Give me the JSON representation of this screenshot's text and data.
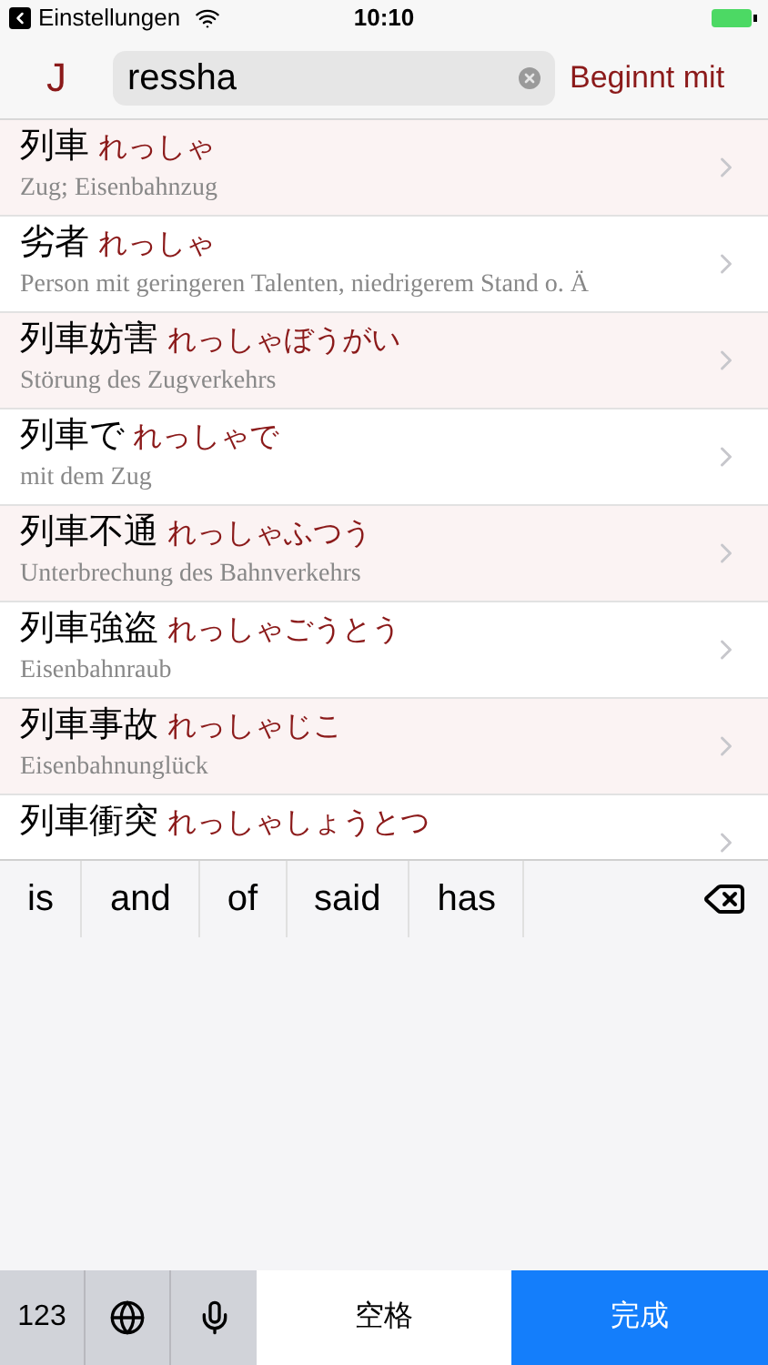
{
  "status_bar": {
    "back_label": "Einstellungen",
    "time": "10:10"
  },
  "nav": {
    "mode_button": "J",
    "search": {
      "value": "ressha"
    },
    "filter_button": "Beginnt mit"
  },
  "results": [
    {
      "word": "列車",
      "reading": "れっしゃ",
      "meaning": "Zug; Eisenbahnzug"
    },
    {
      "word": "劣者",
      "reading": "れっしゃ",
      "meaning": "Person mit geringeren Talenten, niedrigerem Stand o. Ä"
    },
    {
      "word": "列車妨害",
      "reading": "れっしゃぼうがい",
      "meaning": "Störung des Zugverkehrs"
    },
    {
      "word": "列車で",
      "reading": "れっしゃで",
      "meaning": "mit dem Zug"
    },
    {
      "word": "列車不通",
      "reading": "れっしゃふつう",
      "meaning": "Unterbrechung des Bahnverkehrs"
    },
    {
      "word": "列車強盗",
      "reading": "れっしゃごうとう",
      "meaning": "Eisenbahnraub"
    },
    {
      "word": "列車事故",
      "reading": "れっしゃじこ",
      "meaning": "Eisenbahnunglück"
    },
    {
      "word": "列車衝突",
      "reading": "れっしゃしょうとつ"
    }
  ],
  "suggestions": [
    "is",
    "and",
    "of",
    "said",
    "has"
  ],
  "keyboard": {
    "numbers_key": "123",
    "space_key": "空格",
    "done_key": "完成"
  }
}
